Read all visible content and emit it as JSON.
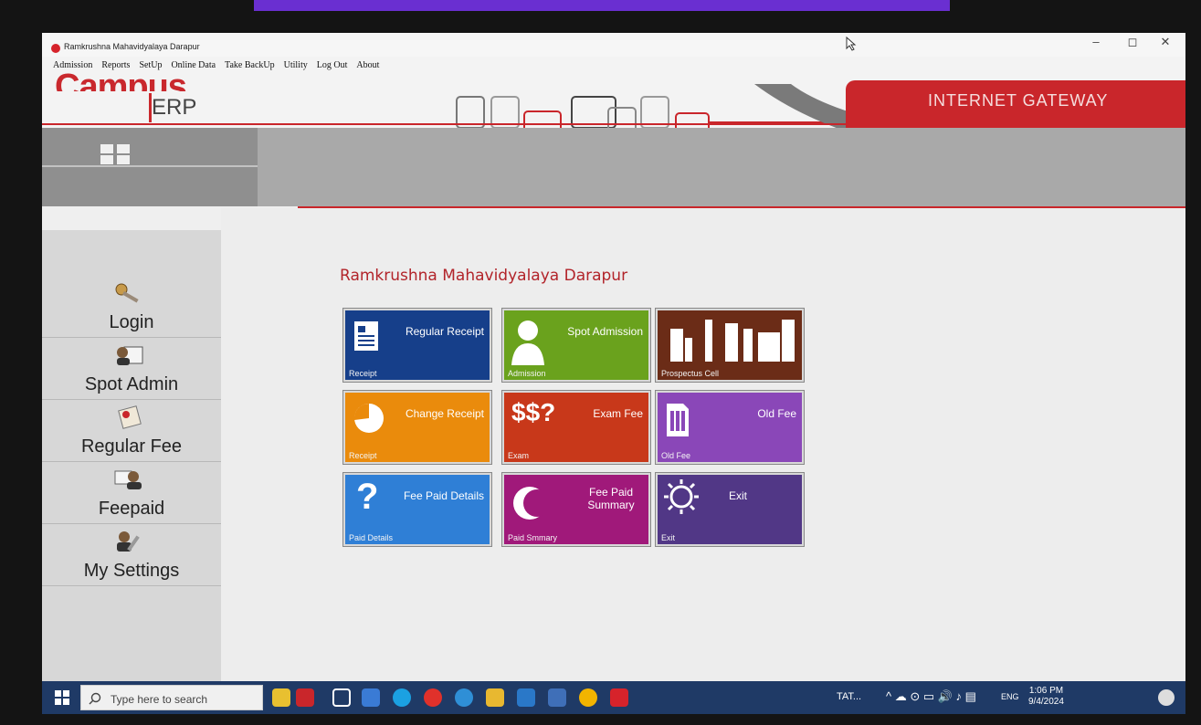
{
  "window": {
    "title": "Ramkrushna Mahavidyalaya Darapur",
    "minimize_glyph": "–",
    "maximize_glyph": "◻",
    "close_glyph": "✕"
  },
  "menu": [
    "Admission",
    "Reports",
    "SetUp",
    "Online Data",
    "Take BackUp",
    "Utility",
    "Log Out",
    "About"
  ],
  "header": {
    "logo_main": "Campus",
    "logo_sub": "ERP",
    "gateway_label": "INTERNET GATEWAY",
    "brand_color": "#c9262b"
  },
  "sidebar": {
    "items": [
      {
        "label": "Login",
        "icon": "key-icon"
      },
      {
        "label": "Spot Admin",
        "icon": "user-id-card-icon"
      },
      {
        "label": "Regular Fee",
        "icon": "fee-sheet-icon"
      },
      {
        "label": "Feepaid",
        "icon": "users-card-icon"
      },
      {
        "label": "My Settings",
        "icon": "user-wrench-icon"
      }
    ]
  },
  "main": {
    "college_name": "Ramkrushna Mahavidyalaya Darapur",
    "tiles": [
      {
        "title": "Regular Receipt",
        "sub": "Receipt",
        "color": "#163f8a",
        "icon": "receipt-icon"
      },
      {
        "title": "Spot Admission",
        "sub": "Admission",
        "color": "#6aa21d",
        "icon": "person-silhouette-icon"
      },
      {
        "title": "",
        "sub": "Prospectus Cell",
        "color": "#6b2c17",
        "icon": "building-chart-icon"
      },
      {
        "title": "Change Receipt",
        "sub": "Receipt",
        "color": "#ea8b0c",
        "icon": "pie-icon"
      },
      {
        "title": "Exam Fee",
        "sub": "Exam",
        "color": "#c8381a",
        "icon": "dollar-question-icon",
        "icon_text": "$$?"
      },
      {
        "title": "Old Fee",
        "sub": "Old Fee",
        "color": "#8a47b8",
        "icon": "document-icon"
      },
      {
        "title": "Fee Paid Details",
        "sub": "Paid Details",
        "color": "#2f7fd6",
        "icon": "question-icon",
        "icon_text": "?"
      },
      {
        "title": "Fee Paid Summary",
        "sub": "Paid Smmary",
        "color": "#a0197a",
        "icon": "crescent-icon"
      },
      {
        "title": "Exit",
        "sub": "Exit",
        "color": "#513786",
        "icon": "sun-icon"
      }
    ]
  },
  "taskbar": {
    "search_placeholder": "Type here to search",
    "tray_app": "TAT...",
    "language": "ENG",
    "time": "1:06 PM",
    "date": "9/4/2024",
    "tray_glyphs": "^ ☁ ⊙ ▭ 🔊 ♪ ▤"
  }
}
